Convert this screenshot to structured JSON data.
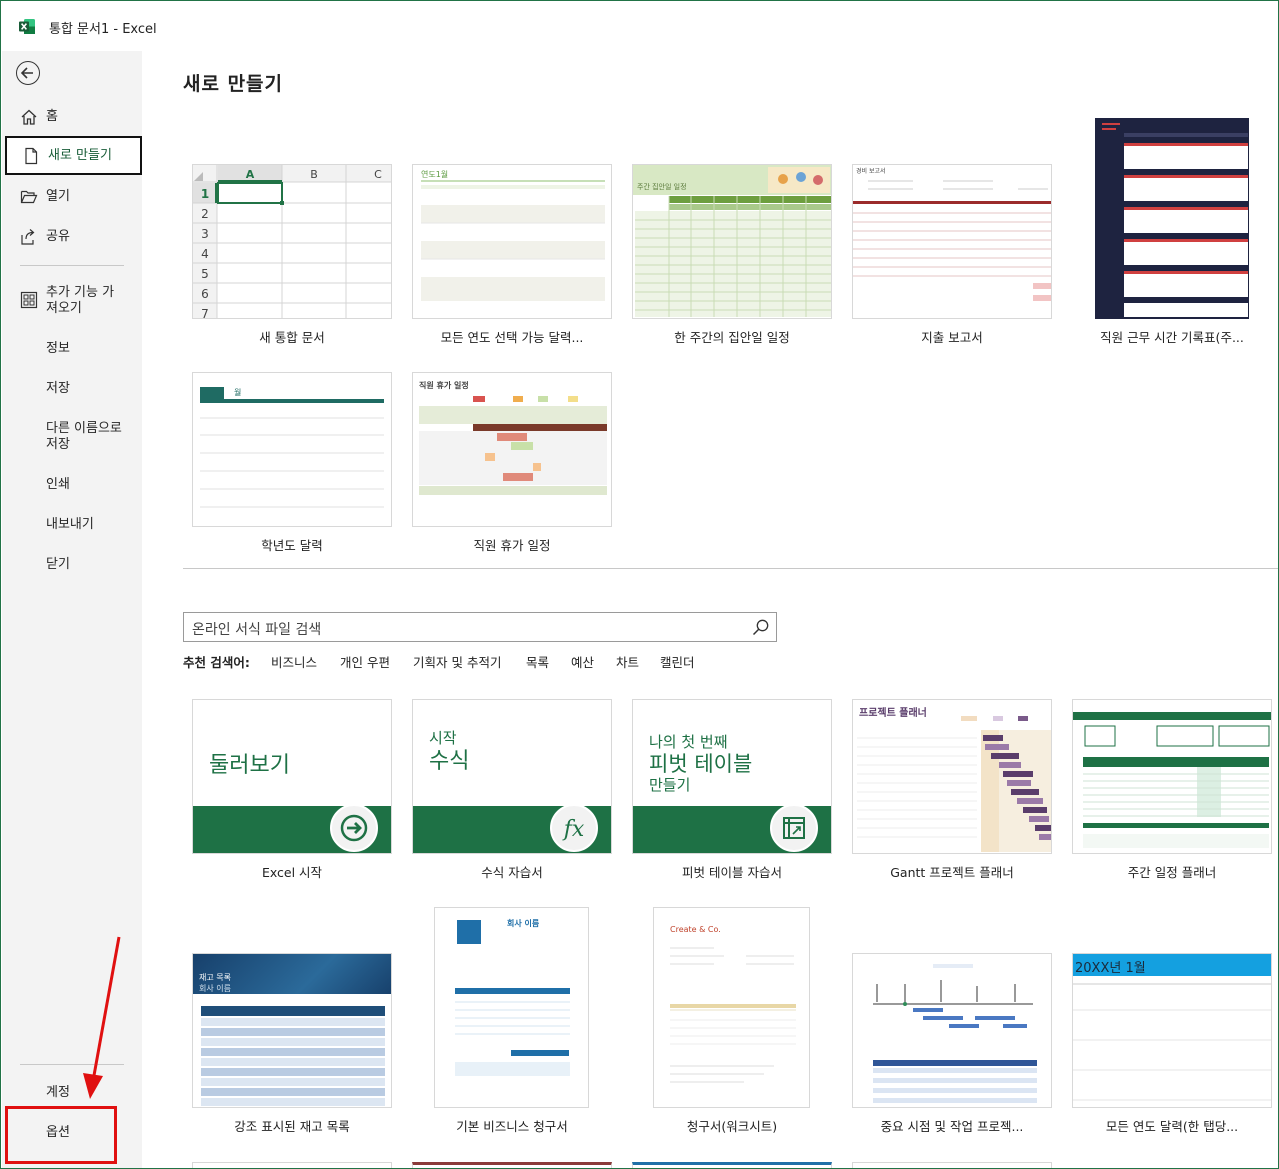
{
  "window": {
    "title": "통합 문서1  -  Excel"
  },
  "sidebar": {
    "items": [
      {
        "label": "홈"
      },
      {
        "label": "새로 만들기"
      },
      {
        "label": "열기"
      },
      {
        "label": "공유"
      },
      {
        "label": "추가 기능 가\n져오기"
      },
      {
        "label": "정보"
      },
      {
        "label": "저장"
      },
      {
        "label": "다른 이름으로\n저장"
      },
      {
        "label": "인쇄"
      },
      {
        "label": "내보내기"
      },
      {
        "label": "닫기"
      },
      {
        "label": "계정"
      },
      {
        "label": "옵션"
      }
    ]
  },
  "main": {
    "title": "새로 만들기",
    "blank_grid": {
      "cols": [
        "A",
        "B",
        "C"
      ],
      "rows": [
        "1",
        "2",
        "3",
        "4",
        "5",
        "6",
        "7"
      ]
    },
    "templates_row1": [
      {
        "name": "새 통합 문서"
      },
      {
        "name": "모든 연도 선택 가능 달력..."
      },
      {
        "name": "한 주간의 집안일 일정"
      },
      {
        "name": "지출 보고서"
      },
      {
        "name": "직원 근무 시간 기록표(주..."
      }
    ],
    "templates_row2": [
      {
        "name": "학년도 달력"
      },
      {
        "name": "직원 휴가 일정"
      }
    ],
    "search": {
      "placeholder": "온라인 서식 파일 검색"
    },
    "suggested": {
      "label": "추천 검색어:",
      "terms": [
        "비즈니스",
        "개인 우편",
        "기획자 및 추적기",
        "목록",
        "예산",
        "차트",
        "캘린더"
      ]
    },
    "templates_row3": [
      {
        "name": "Excel 시작",
        "thumb": "둘러보기"
      },
      {
        "name": "수식 자습서",
        "thumb1": "시작",
        "thumb2": "수식"
      },
      {
        "name": "피벗 테이블 자습서",
        "thumb1": "나의 첫 번째",
        "thumb2": "피벗 테이블",
        "thumb3": "만들기"
      },
      {
        "name": "Gantt 프로젝트 플래너",
        "thumb": "프로젝트 플래너"
      },
      {
        "name": "주간 일정 플래너"
      }
    ],
    "templates_row4": [
      {
        "name": "강조 표시된 재고 목록",
        "thumb1": "재고 목록",
        "thumb2": "회사 이름"
      },
      {
        "name": "기본 비즈니스 청구서",
        "thumb": "회사 이름"
      },
      {
        "name": "청구서(워크시트)",
        "thumb": "Create & Co."
      },
      {
        "name": "중요 시점 및 작업 프로젝..."
      },
      {
        "name": "모든 연도 달력(한 탭당...",
        "thumb": "20XX년 1월"
      }
    ]
  },
  "colors": {
    "excel_green": "#217346",
    "tile_green": "#1e7145",
    "highlight_red": "#e01010"
  }
}
